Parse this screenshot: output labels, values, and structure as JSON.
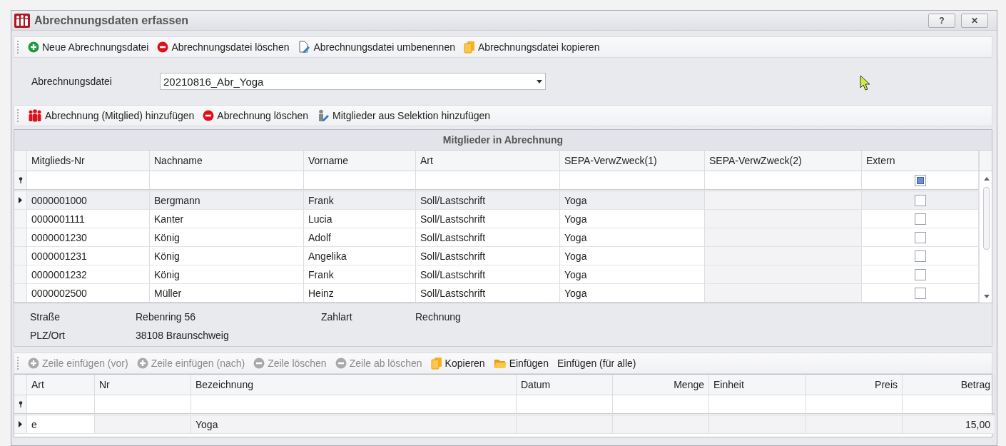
{
  "window": {
    "title": "Abrechnungsdaten erfassen",
    "buttons": [
      "?",
      "✕"
    ]
  },
  "file_toolbar": {
    "items": [
      {
        "label": "Neue Abrechnungsdatei",
        "kind": "add",
        "disabled": false
      },
      {
        "label": "Abrechnungsdatei löschen",
        "kind": "remove",
        "disabled": false
      },
      {
        "label": "Abrechnungsdatei umbenennen",
        "kind": "rename",
        "disabled": false
      },
      {
        "label": "Abrechnungsdatei kopieren",
        "kind": "copy",
        "disabled": false
      }
    ]
  },
  "file_field": {
    "label": "Abrechnungsdatei",
    "value": "20210816_Abr_Yoga"
  },
  "member_toolbar": {
    "items": [
      {
        "label": "Abrechnung (Mitglied) hinzufügen",
        "kind": "people",
        "disabled": false
      },
      {
        "label": "Abrechnung löschen",
        "kind": "remove",
        "disabled": false
      },
      {
        "label": "Mitglieder aus Selektion hinzufügen",
        "kind": "person",
        "disabled": false
      }
    ]
  },
  "members": {
    "title": "Mitglieder in Abrechnung",
    "filter_extern_indeterminate": true,
    "columns": [
      "Mitglieds-Nr",
      "Nachname",
      "Vorname",
      "Art",
      "SEPA-VerwZweck(1)",
      "SEPA-VerwZweck(2)",
      "Extern"
    ],
    "rows": [
      {
        "nr": "0000001000",
        "nachname": "Bergmann",
        "vorname": "Frank",
        "art": "Soll/Lastschrift",
        "sepa1": "Yoga",
        "extern": false,
        "selected": true
      },
      {
        "nr": "0000001111",
        "nachname": "Kanter",
        "vorname": "Lucia",
        "art": "Soll/Lastschrift",
        "sepa1": "Yoga",
        "extern": false,
        "selected": false
      },
      {
        "nr": "0000001230",
        "nachname": "König",
        "vorname": "Adolf",
        "art": "Soll/Lastschrift",
        "sepa1": "Yoga",
        "extern": false,
        "selected": false
      },
      {
        "nr": "0000001231",
        "nachname": "König",
        "vorname": "Angelika",
        "art": "Soll/Lastschrift",
        "sepa1": "Yoga",
        "extern": false,
        "selected": false
      },
      {
        "nr": "0000001232",
        "nachname": "König",
        "vorname": "Frank",
        "art": "Soll/Lastschrift",
        "sepa1": "Yoga",
        "extern": false,
        "selected": false
      },
      {
        "nr": "0000002500",
        "nachname": "Müller",
        "vorname": "Heinz",
        "art": "Soll/Lastschrift",
        "sepa1": "Yoga",
        "extern": false,
        "selected": false
      }
    ]
  },
  "details": {
    "fields": [
      {
        "label": "Straße",
        "value": "Rebenring 56"
      },
      {
        "label": "Zahlart",
        "value": "Rechnung"
      },
      {
        "label": "PLZ/Ort",
        "value": "38108 Braunschweig"
      }
    ]
  },
  "positions_toolbar": {
    "items": [
      {
        "label": "Zeile einfügen (vor)",
        "kind": "add",
        "disabled": true
      },
      {
        "label": "Zeile einfügen (nach)",
        "kind": "add",
        "disabled": true
      },
      {
        "label": "Zeile löschen",
        "kind": "remove",
        "disabled": true
      },
      {
        "label": "Zeile ab löschen",
        "kind": "remove",
        "disabled": true
      },
      {
        "label": "Kopieren",
        "kind": "copy",
        "disabled": false
      },
      {
        "label": "Einfügen",
        "kind": "folder",
        "disabled": false
      },
      {
        "label": "Einfügen (für alle)",
        "kind": "text",
        "disabled": false
      }
    ]
  },
  "positions": {
    "columns": [
      "Art",
      "Nr",
      "Bezeichnung",
      "Datum",
      "Menge",
      "Einheit",
      "Preis",
      "Betrag"
    ],
    "rows": [
      {
        "art": "e",
        "bezeichnung": "Yoga",
        "betrag": "15,00",
        "selected": true,
        "editing": true
      }
    ]
  }
}
